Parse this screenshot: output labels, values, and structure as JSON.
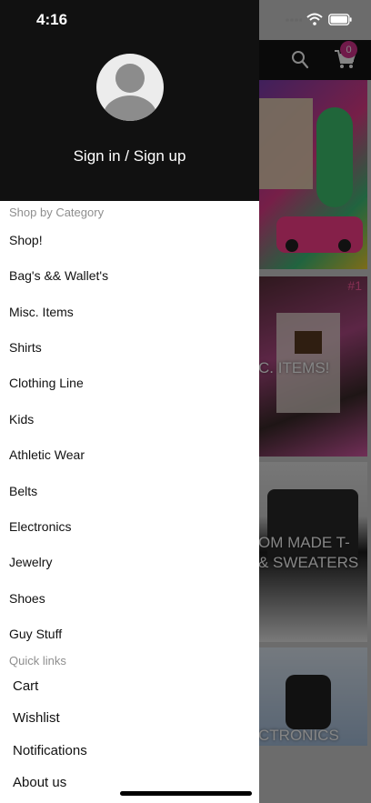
{
  "status_bar": {
    "time": "4:16"
  },
  "app_header": {
    "cart_count": "0"
  },
  "tiles": [
    {
      "label": "",
      "rank": ""
    },
    {
      "label": "C. ITEMS!",
      "rank": "#1"
    },
    {
      "label": "OM MADE T-\n& SWEATERS",
      "rank": ""
    },
    {
      "label": "CTRONICS",
      "rank": ""
    }
  ],
  "drawer": {
    "signin_label": "Sign in / Sign up",
    "category_heading": "Shop by Category",
    "categories": [
      "Shop!",
      "Bag's && Wallet's",
      "Misc. Items",
      "Shirts",
      "Clothing Line",
      "Kids",
      "Athletic Wear",
      "Belts",
      "Electronics",
      "Jewelry",
      "Shoes",
      "Guy Stuff"
    ],
    "quick_heading": "Quick links",
    "quick_links": [
      "Cart",
      "Wishlist",
      "Notifications",
      "About us"
    ]
  },
  "colors": {
    "accent_badge": "#d6338f",
    "drawer_header": "#111111"
  }
}
